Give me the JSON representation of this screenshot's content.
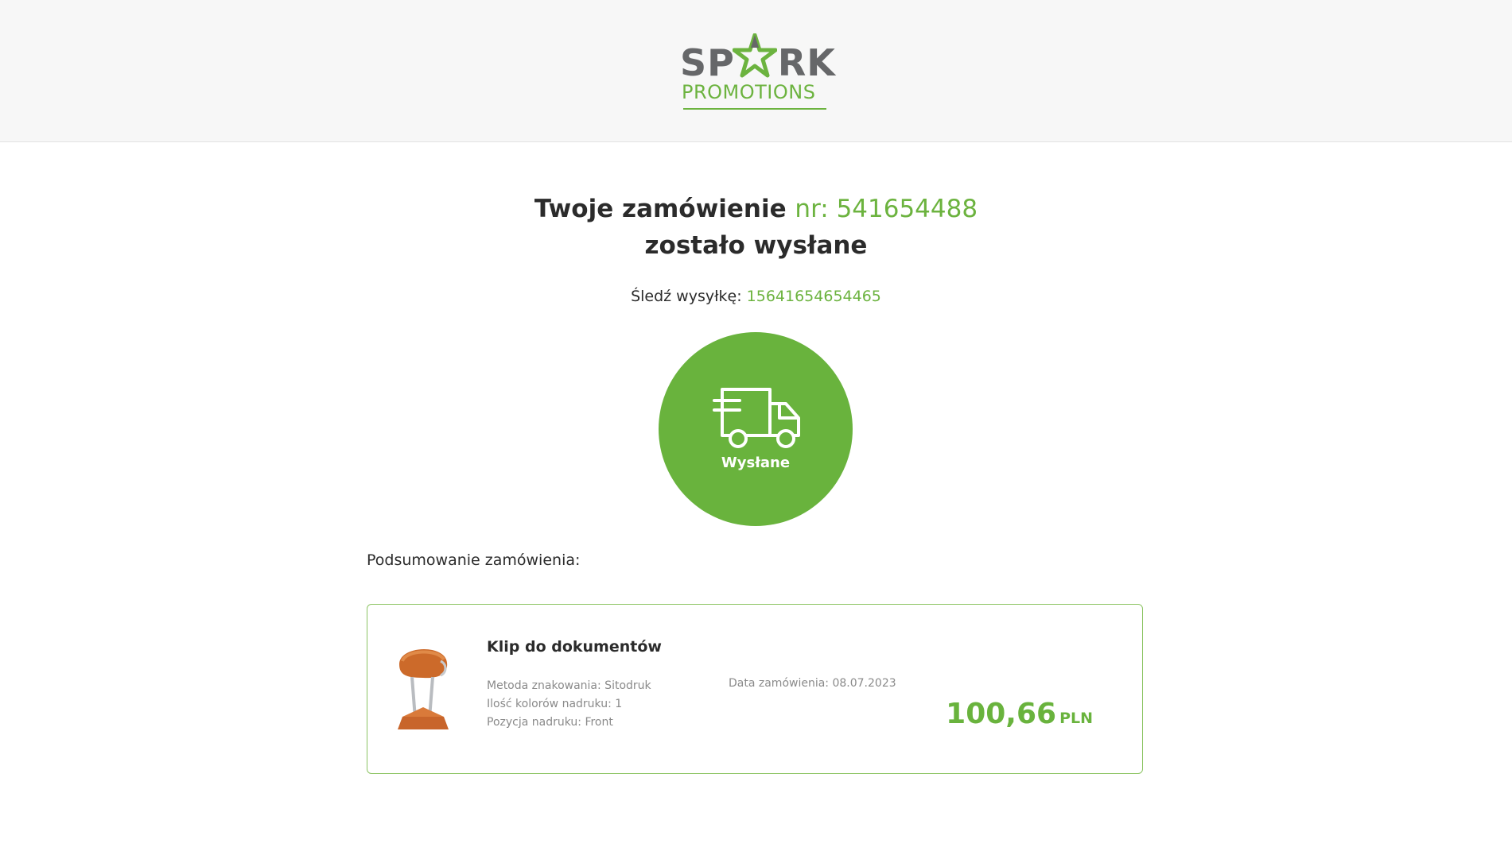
{
  "brand": {
    "logo_top_left": "SP",
    "logo_top_right": "RK",
    "logo_bottom": "PROMOTIONS",
    "logo_name": "spark-promotions-logo"
  },
  "order": {
    "title_prefix": "Twoje zamówienie",
    "number_label": "nr: 541654488",
    "title_suffix": "zostało wysłane",
    "tracking_label": "Śledź wysyłkę:",
    "tracking_number": "15641654654465",
    "status_icon": "delivery-truck-icon",
    "status": "Wysłane"
  },
  "summary": {
    "label": "Podsumowanie zamówienia:",
    "item": {
      "image": "binder-clip-image",
      "name": "Klip do dokumentów",
      "specs": [
        "Metoda znakowania: Sitodruk",
        "Ilość kolorów nadruku: 1",
        "Pozycja nadruku: Front"
      ],
      "order_date": "Data zamówienia: 08.07.2023",
      "price": "100,66",
      "currency": "PLN"
    }
  },
  "colors": {
    "accent_green": "#69b33d",
    "logo_grey": "#666769",
    "header_bg": "#f7f7f7"
  }
}
